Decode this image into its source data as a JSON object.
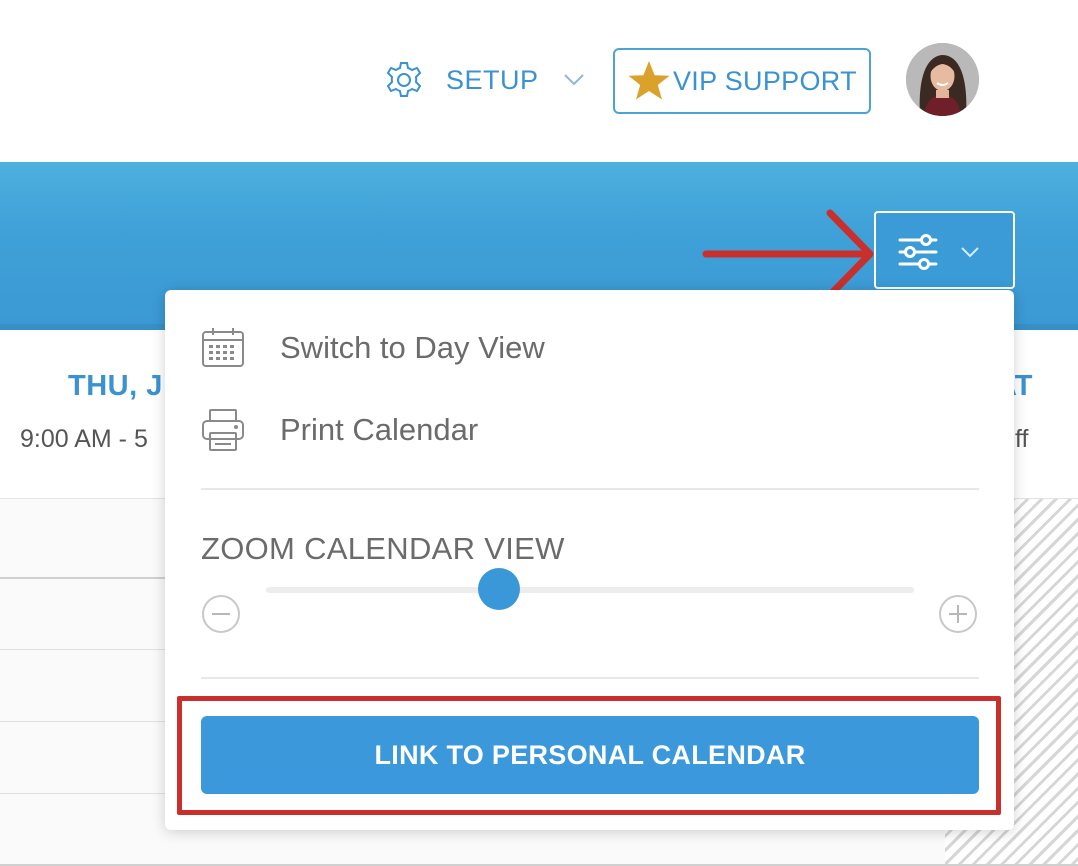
{
  "header": {
    "setup_label": "SETUP",
    "vip_label": "VIP SUPPORT"
  },
  "calendar": {
    "days": [
      {
        "label": "THU, J",
        "hours": "9:00 AM - 5"
      },
      {
        "label": "AT",
        "hours": "ff"
      }
    ]
  },
  "menu": {
    "day_view_label": "Switch to Day View",
    "print_label": "Print Calendar",
    "zoom_title": "ZOOM CALENDAR VIEW",
    "zoom_level": 0.36,
    "link_button_label": "LINK TO PERSONAL CALENDAR"
  },
  "colors": {
    "accent": "#3b98d8",
    "banner": "#3fa1d8",
    "annotation": "#c9302c",
    "star": "#dba22b"
  },
  "icons": [
    "gear-icon",
    "chevron-down-icon",
    "star-icon",
    "sliders-icon",
    "calendar-icon",
    "printer-icon",
    "zoom-out-icon",
    "zoom-in-icon",
    "arrow-annotation"
  ]
}
